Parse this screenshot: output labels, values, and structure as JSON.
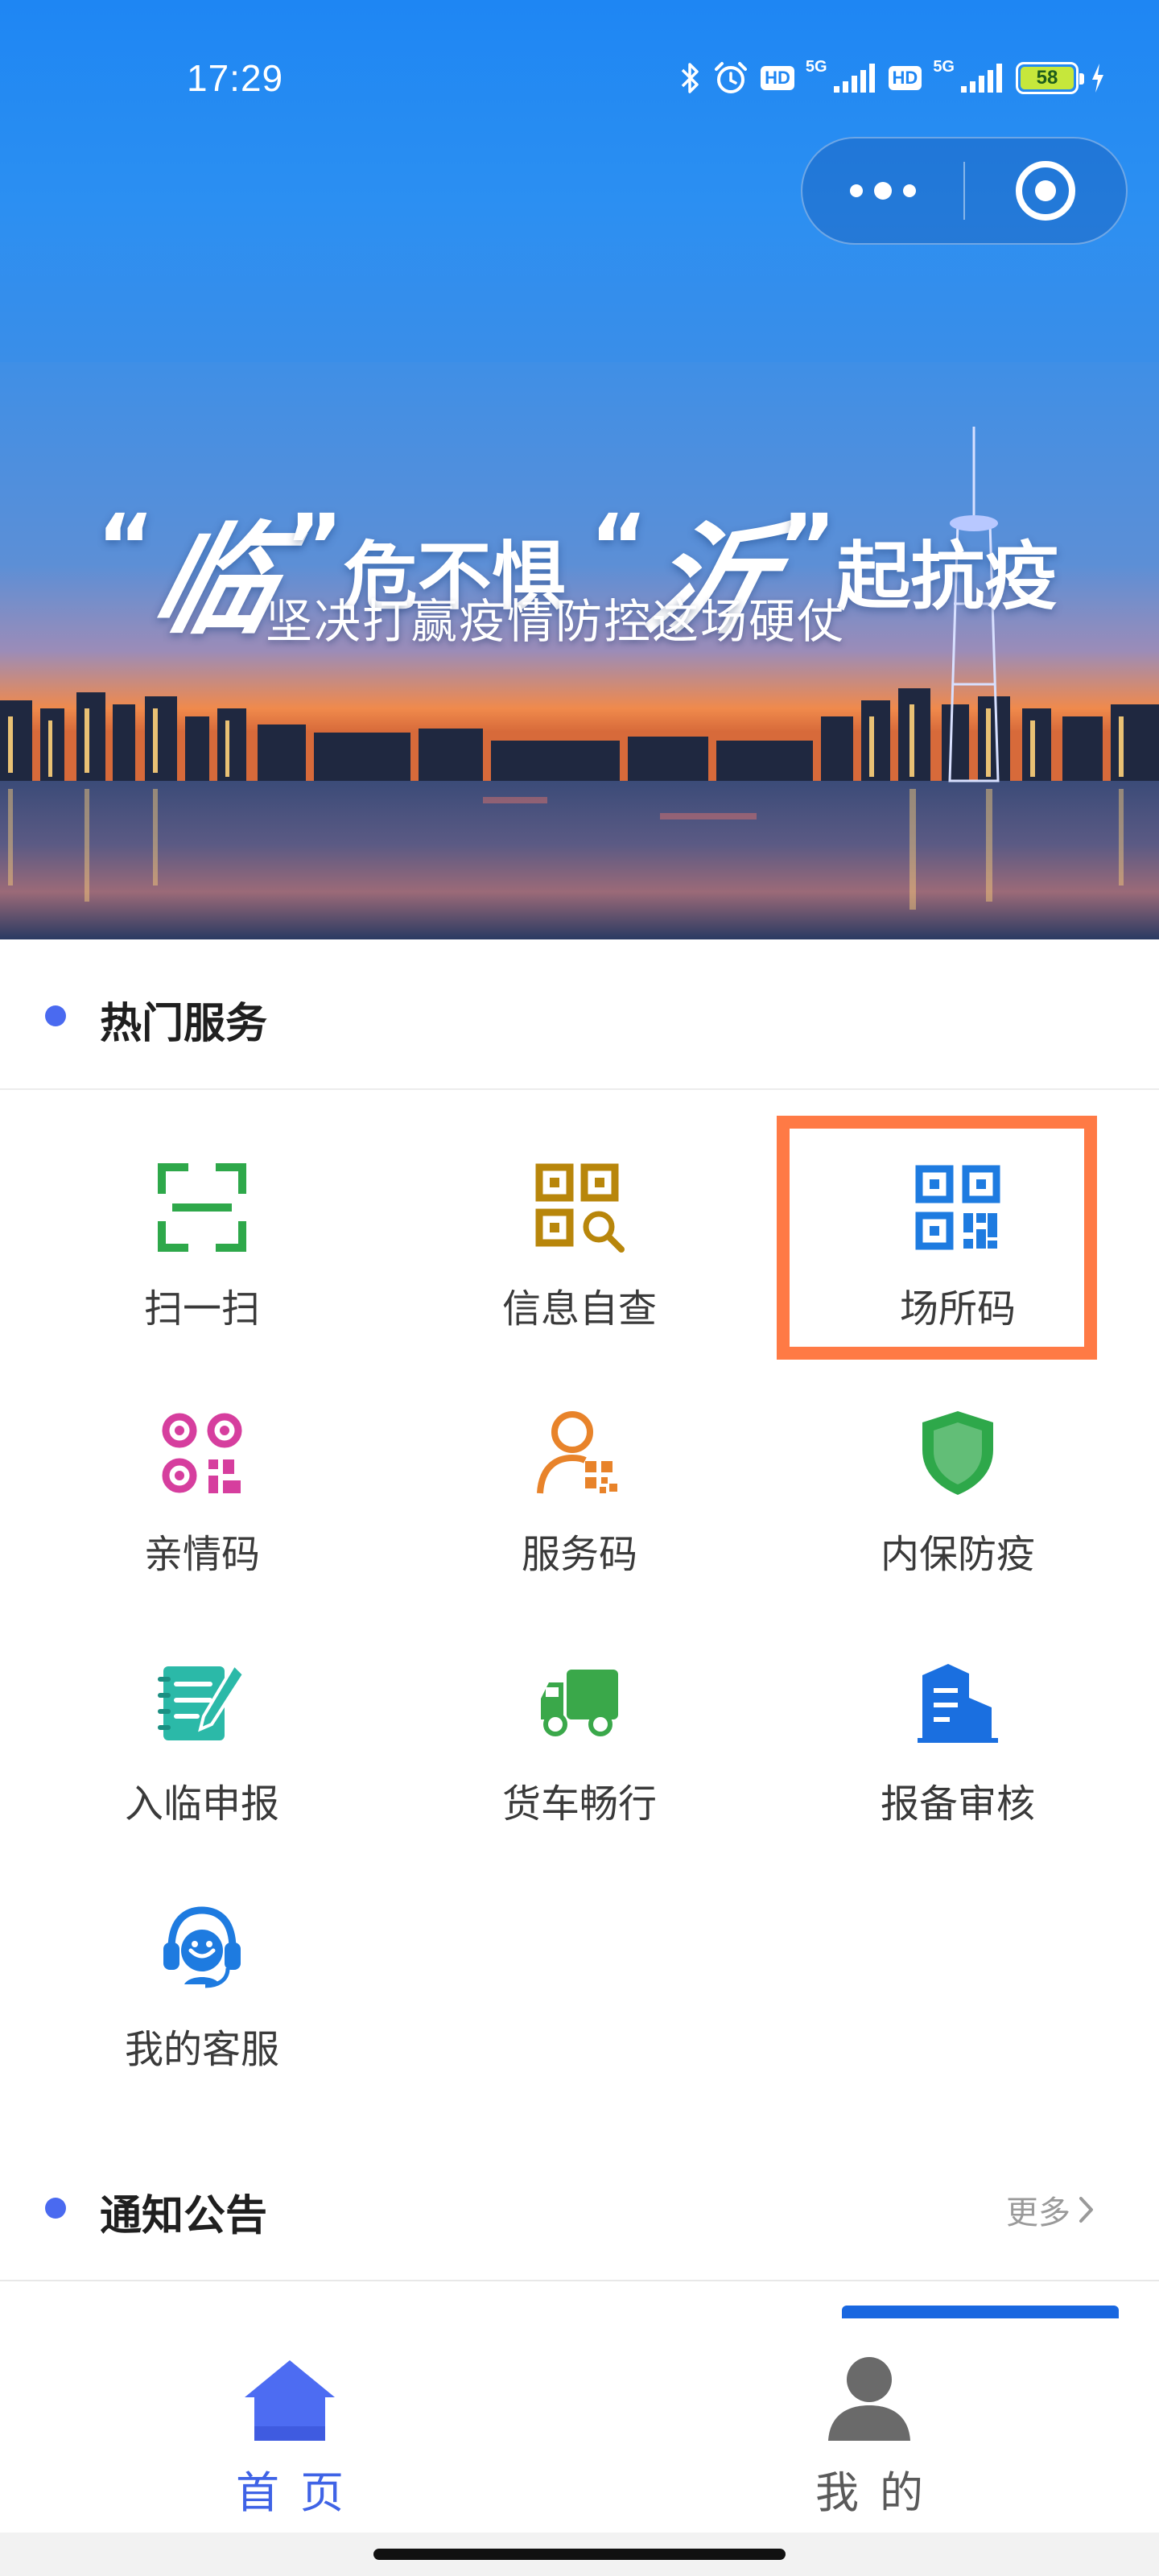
{
  "status_bar": {
    "time": "17:29",
    "battery_level": "58",
    "network_label": "5G",
    "hd_label": "HD",
    "icons": [
      "bluetooth-icon",
      "alarm-icon",
      "hd-icon",
      "signal-icon",
      "hd-icon",
      "signal-icon",
      "battery-icon",
      "charging-icon"
    ]
  },
  "capsule": {
    "more_icon": "more-dots-icon",
    "close_icon": "target-close-icon"
  },
  "banner": {
    "title_quote_open_1": "“",
    "title_calli_1": "临",
    "title_quote_close_1": "”",
    "title_text_1": "危不惧",
    "title_quote_open_2": "“",
    "title_calli_2": "沂",
    "title_quote_close_2": "”",
    "title_text_2": "起抗疫",
    "subtitle": "坚决打赢疫情防控这场硬仗"
  },
  "hot_services": {
    "title": "热门服务",
    "items": [
      {
        "label": "扫一扫",
        "icon": "scan-icon",
        "color": "#2ea84a"
      },
      {
        "label": "信息自查",
        "icon": "qr-search-icon",
        "color": "#b8860b"
      },
      {
        "label": "场所码",
        "icon": "qr-code-icon",
        "color": "#1e7be0"
      },
      {
        "label": "亲情码",
        "icon": "family-qr-icon",
        "color": "#d63e9e"
      },
      {
        "label": "服务码",
        "icon": "person-qr-icon",
        "color": "#e8832a"
      },
      {
        "label": "内保防疫",
        "icon": "shield-icon",
        "color": "#2ea84a"
      },
      {
        "label": "入临申报",
        "icon": "notebook-pen-icon",
        "color": "#2bb9a8"
      },
      {
        "label": "货车畅行",
        "icon": "truck-icon",
        "color": "#3aa84a"
      },
      {
        "label": "报备审核",
        "icon": "building-icon",
        "color": "#1a6fe0"
      },
      {
        "label": "我的客服",
        "icon": "headset-icon",
        "color": "#1e7be0"
      }
    ],
    "highlighted": "场所码",
    "highlight_color": "#ff7a45"
  },
  "notices": {
    "title": "通知公告",
    "more_label": "更多",
    "more_icon": "chevron-right-icon"
  },
  "tabbar": {
    "tabs": [
      {
        "label": "首页",
        "icon": "home-icon",
        "active": true
      },
      {
        "label": "我的",
        "icon": "user-icon",
        "active": false
      }
    ],
    "active_color": "#3f63e6",
    "inactive_color": "#5a5a5a"
  },
  "colors": {
    "header_blue": "#1e86f3",
    "section_dot": "#4a6af0"
  }
}
